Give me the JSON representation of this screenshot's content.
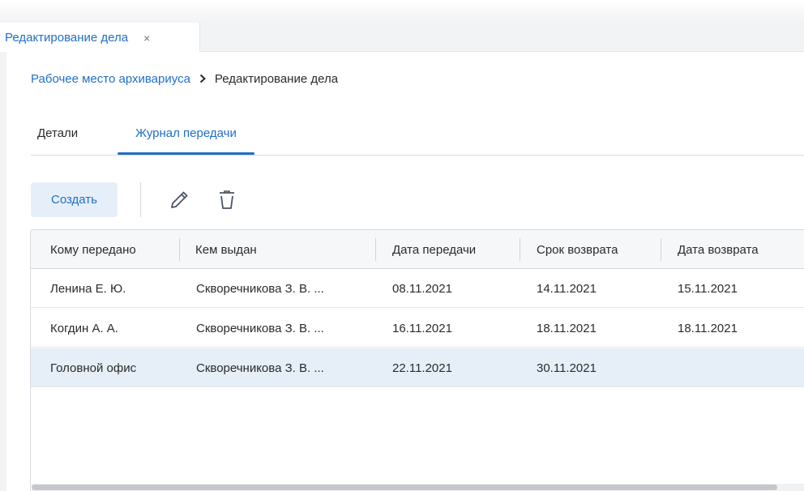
{
  "window_tab": {
    "title": "Редактирование дела",
    "close": "×"
  },
  "breadcrumb": {
    "parent": "Рабочее место архивариуса",
    "current": "Редактирование дела"
  },
  "tabs": [
    {
      "label": "Детали",
      "active": false
    },
    {
      "label": "Журнал передачи",
      "active": true
    }
  ],
  "toolbar": {
    "create_label": "Создать",
    "edit_icon": "pencil-icon",
    "delete_icon": "trash-icon"
  },
  "table": {
    "columns": [
      "Кому передано",
      "Кем выдан",
      "Дата передачи",
      "Срок возврата",
      "Дата возврата"
    ],
    "rows": [
      [
        "Ленина Е. Ю.",
        "Скворечникова З. В. ...",
        "08.11.2021",
        "14.11.2021",
        "15.11.2021"
      ],
      [
        "Когдин А. А.",
        "Скворечникова З. В. ...",
        "16.11.2021",
        "18.11.2021",
        "18.11.2021"
      ],
      [
        "Головной офис",
        "Скворечникова З. В. ...",
        "22.11.2021",
        "30.11.2021",
        ""
      ]
    ],
    "selected_row": 2
  },
  "colors": {
    "accent": "#1f6fc5",
    "selected_row": "#e6eef7",
    "header_bg": "#f5f7f9"
  }
}
